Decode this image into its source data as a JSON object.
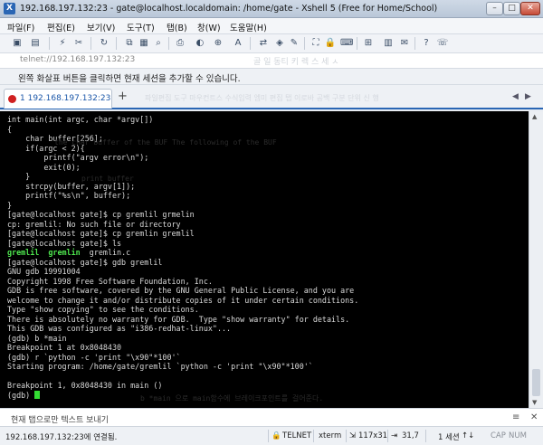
{
  "window": {
    "title": "192.168.197.132:23 - gate@localhost.localdomain: /home/gate - Xshell 5 (Free for Home/School)",
    "min_glyph": "–",
    "max_glyph": "□",
    "close_glyph": "✕"
  },
  "menu": [
    "파일(F)",
    "편집(E)",
    "보기(V)",
    "도구(T)",
    "탭(B)",
    "창(W)",
    "도움말(H)"
  ],
  "address": {
    "value": "telnet://192.168.197.132:23",
    "ghost_text": "골   일   동티   키 렉 스   세 ㅅ"
  },
  "info": {
    "text": "왼쪽 화살표 버튼을 클릭하면 현재 세션을 추가할 수 있습니다."
  },
  "tabs": {
    "active_label": "1 192.168.197.132:23",
    "add_glyph": "+",
    "ghost_text": "파일편집   도구   마우컨트스   수식입력   엠미   편집   탭   이로바   공백   구분   단위 신 행"
  },
  "terminal": {
    "lines": [
      {
        "text": "int main(int argc, char *argv[])",
        "kind": "normal"
      },
      {
        "text": "{",
        "kind": "normal"
      },
      {
        "text": "    char buffer[256];",
        "kind": "normal"
      },
      {
        "text": "    if(argc < 2){",
        "kind": "normal"
      },
      {
        "text": "        printf(\"argv error\\n\");",
        "kind": "normal"
      },
      {
        "text": "        exit(0);",
        "kind": "normal"
      },
      {
        "text": "    }",
        "kind": "normal"
      },
      {
        "text": "    strcpy(buffer, argv[1]);",
        "kind": "normal"
      },
      {
        "text": "    printf(\"%s\\n\", buffer);",
        "kind": "normal"
      },
      {
        "text": "}",
        "kind": "normal"
      },
      {
        "text": "[gate@localhost gate]$ cp gremlil grmelin",
        "kind": "normal"
      },
      {
        "text": "cp: gremlil: No such file or directory",
        "kind": "normal"
      },
      {
        "text": "[gate@localhost gate]$ cp gremlin gremlil",
        "kind": "normal"
      },
      {
        "text": "[gate@localhost gate]$ ls",
        "kind": "normal"
      },
      {
        "text": "gremlil  gremlin  gremlin.c",
        "kind": "ls"
      },
      {
        "text": "[gate@localhost gate]$ gdb gremlil",
        "kind": "normal"
      },
      {
        "text": "GNU gdb 19991004",
        "kind": "normal"
      },
      {
        "text": "Copyright 1998 Free Software Foundation, Inc.",
        "kind": "normal"
      },
      {
        "text": "GDB is free software, covered by the GNU General Public License, and you are",
        "kind": "normal"
      },
      {
        "text": "welcome to change it and/or distribute copies of it under certain conditions.",
        "kind": "normal"
      },
      {
        "text": "Type \"show copying\" to see the conditions.",
        "kind": "normal"
      },
      {
        "text": "There is absolutely no warranty for GDB.  Type \"show warranty\" for details.",
        "kind": "normal"
      },
      {
        "text": "This GDB was configured as \"i386-redhat-linux\"...",
        "kind": "normal"
      },
      {
        "text": "(gdb) b *main",
        "kind": "normal"
      },
      {
        "text": "Breakpoint 1 at 0x8048430",
        "kind": "normal"
      },
      {
        "text": "(gdb) r `python -c 'print \"\\x90\"*100'`",
        "kind": "normal"
      },
      {
        "text": "Starting program: /home/gate/gremlil `python -c 'print \"\\x90\"*100'`",
        "kind": "normal"
      },
      {
        "text": "",
        "kind": "normal"
      },
      {
        "text": "Breakpoint 1, 0x8048430 in main ()",
        "kind": "normal"
      },
      {
        "text": "(gdb) ",
        "kind": "prompt"
      }
    ],
    "ls_names": [
      "gremlil",
      "gremlin",
      "gremlin.c"
    ],
    "ghost_lines": [
      "  the char buffer of the BUF  The following of the BUF",
      "  print buffer",
      "b *main 으로 main함수에 브레이크포인트를 걸어준다."
    ]
  },
  "compose": {
    "text": "현재 탭으로만 텍스트 보내기",
    "menu_glyph": "≡",
    "close_glyph": "✕"
  },
  "status": {
    "connection": "192.168.197.132:23에 연결됨.",
    "protocol": "TELNET",
    "term": "xterm",
    "size": "117x31",
    "cursor": "31,7",
    "sessions": "1 세션",
    "caps": "CAP",
    "num": "NUM"
  },
  "colors": {
    "terminal_bg": "#000000",
    "terminal_fg": "#d9d9d9",
    "ls_highlight": "#4fe84f",
    "accent": "#2a66b4"
  }
}
